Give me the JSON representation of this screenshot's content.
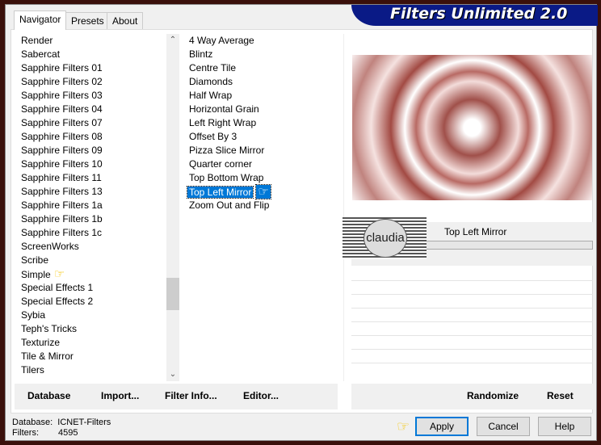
{
  "title": "Filters Unlimited 2.0",
  "tabs": [
    {
      "label": "Navigator"
    },
    {
      "label": "Presets"
    },
    {
      "label": "About"
    }
  ],
  "categories": [
    "Render",
    "Sabercat",
    "Sapphire Filters 01",
    "Sapphire Filters 02",
    "Sapphire Filters 03",
    "Sapphire Filters 04",
    "Sapphire Filters 07",
    "Sapphire Filters 08",
    "Sapphire Filters 09",
    "Sapphire Filters 10",
    "Sapphire Filters 11",
    "Sapphire Filters 13",
    "Sapphire Filters 1a",
    "Sapphire Filters 1b",
    "Sapphire Filters 1c",
    "ScreenWorks",
    "Scribe",
    "Simple",
    "Special Effects 1",
    "Special Effects 2",
    "Sybia",
    "Teph's Tricks",
    "Texturize",
    "Tile & Mirror",
    "Tilers"
  ],
  "filters": [
    "4 Way Average",
    "Blintz",
    "Centre Tile",
    "Diamonds",
    "Half Wrap",
    "Horizontal Grain",
    "Left Right Wrap",
    "Offset By 3",
    "Pizza Slice Mirror",
    "Quarter corner",
    "Top Bottom Wrap",
    "Top Left Mirror",
    "Zoom Out and Flip"
  ],
  "selected_filter": "Top Left Mirror",
  "selected_category": "Simple",
  "scrollbar_position": 0.8,
  "preview": {
    "filter_name": "Top Left Mirror",
    "watermark": "claudia"
  },
  "toolbar": {
    "database": "Database",
    "import": "Import...",
    "filter_info": "Filter Info...",
    "editor": "Editor...",
    "randomize": "Randomize",
    "reset": "Reset"
  },
  "status": {
    "database_label": "Database:",
    "database_value": "ICNET-Filters",
    "filters_label": "Filters:",
    "filters_value": "4595"
  },
  "buttons": {
    "apply": "Apply",
    "cancel": "Cancel",
    "help": "Help"
  },
  "colors": {
    "banner": "#0a1a86",
    "selection": "#0078d7",
    "frame": "#3a100b"
  }
}
